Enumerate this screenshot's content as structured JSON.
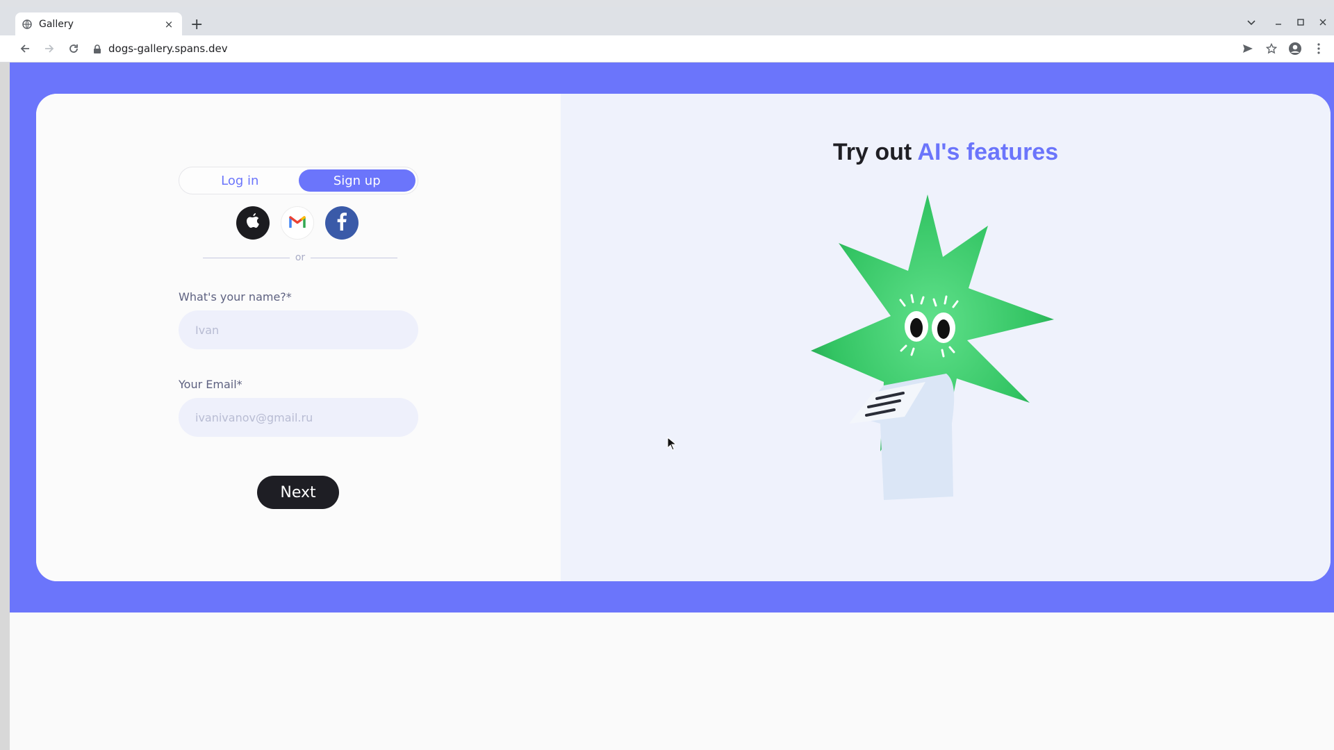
{
  "browser": {
    "tab_title": "Gallery",
    "tab_close": "×",
    "new_tab": "+",
    "url": "dogs-gallery.spans.dev",
    "icons": [
      "globe-icon",
      "back-arrow-icon",
      "forward-arrow-icon",
      "reload-icon",
      "lock-icon",
      "send-icon",
      "star-icon",
      "profile-icon",
      "kebab-menu-icon",
      "chevron-down-icon",
      "minimize-icon",
      "maximize-icon",
      "close-icon"
    ]
  },
  "auth": {
    "login_label": "Log in",
    "signup_label": "Sign up",
    "active_tab": "Sign up",
    "or_text": "or",
    "name_label": "What's your name?*",
    "name_placeholder": "Ivan",
    "email_label": "Your Email*",
    "email_placeholder": "ivanivanov@gmail.ru",
    "next_label": "Next",
    "social_icons": [
      "apple-icon",
      "gmail-icon",
      "facebook-icon"
    ]
  },
  "promo": {
    "title_plain": "Try out ",
    "title_accent": "AI's features"
  },
  "colors": {
    "accent": "#6b75fb",
    "dark_button": "#1e1e24",
    "mascot_green": "#3ecb6b",
    "facebook": "#3a5aa8"
  }
}
